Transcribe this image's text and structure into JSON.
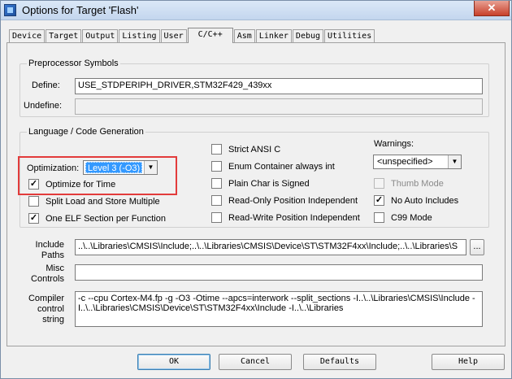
{
  "window": {
    "title": "Options for Target 'Flash'",
    "close_glyph": "✕"
  },
  "tabs": [
    {
      "label": "Device"
    },
    {
      "label": "Target"
    },
    {
      "label": "Output"
    },
    {
      "label": "Listing"
    },
    {
      "label": "User"
    },
    {
      "label": "C/C++",
      "active": true
    },
    {
      "label": "Asm"
    },
    {
      "label": "Linker"
    },
    {
      "label": "Debug"
    },
    {
      "label": "Utilities"
    }
  ],
  "preprocessor": {
    "legend": "Preprocessor Symbols",
    "define_label": "Define:",
    "define_value": "USE_STDPERIPH_DRIVER,STM32F429_439xx",
    "undefine_label": "Undefine:",
    "undefine_value": ""
  },
  "language": {
    "legend": "Language / Code Generation",
    "optimization_label": "Optimization:",
    "optimization_value": "Level 3 (-O3)",
    "optimize_for_time": {
      "label": "Optimize for Time",
      "checked": true
    },
    "split_load_store": {
      "label": "Split Load and Store Multiple",
      "checked": false
    },
    "one_elf_section": {
      "label": "One ELF Section per Function",
      "checked": true
    },
    "strict_ansi_c": {
      "label": "Strict ANSI C",
      "checked": false
    },
    "enum_container_int": {
      "label": "Enum Container always int",
      "checked": false
    },
    "plain_char_signed": {
      "label": "Plain Char is Signed",
      "checked": false
    },
    "ro_position_independent": {
      "label": "Read-Only Position Independent",
      "checked": false
    },
    "rw_position_independent": {
      "label": "Read-Write Position Independent",
      "checked": false
    },
    "warnings_label": "Warnings:",
    "warnings_value": "<unspecified>",
    "thumb_mode": {
      "label": "Thumb Mode",
      "checked": false,
      "disabled": true
    },
    "no_auto_includes": {
      "label": "No Auto Includes",
      "checked": true
    },
    "c99_mode": {
      "label": "C99 Mode",
      "checked": false
    }
  },
  "include_paths": {
    "label_line1": "Include",
    "label_line2": "Paths",
    "value": "..\\..\\Libraries\\CMSIS\\Include;..\\..\\Libraries\\CMSIS\\Device\\ST\\STM32F4xx\\Include;..\\..\\Libraries\\S",
    "browse_label": "..."
  },
  "misc_controls": {
    "label_line1": "Misc",
    "label_line2": "Controls",
    "value": ""
  },
  "compiler_control": {
    "label_line1": "Compiler",
    "label_line2": "control",
    "label_line3": "string",
    "value": "-c --cpu Cortex-M4.fp -g -O3 -Otime --apcs=interwork --split_sections -I..\\..\\Libraries\\CMSIS\\Include -I..\\..\\Libraries\\CMSIS\\Device\\ST\\STM32F4xx\\Include -I..\\..\\Libraries"
  },
  "buttons": {
    "ok": "OK",
    "cancel": "Cancel",
    "defaults": "Defaults",
    "help": "Help"
  },
  "colors": {
    "highlight": "#e23b3b",
    "selection": "#3399ff"
  }
}
